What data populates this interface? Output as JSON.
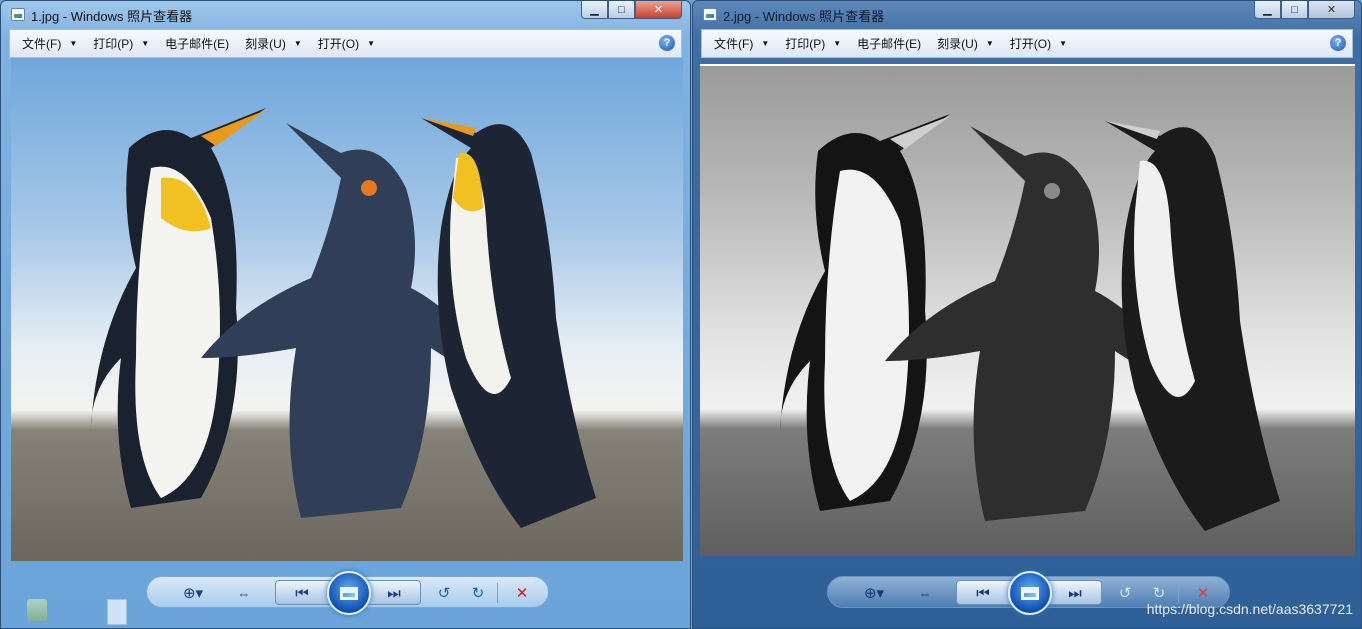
{
  "windows": [
    {
      "title": "1.jpg - Windows 照片查看器",
      "menu": [
        {
          "label": "文件(F)",
          "has_arrow": true
        },
        {
          "label": "打印(P)",
          "has_arrow": true
        },
        {
          "label": "电子邮件(E)",
          "has_arrow": false
        },
        {
          "label": "刻录(U)",
          "has_arrow": true
        },
        {
          "label": "打开(O)",
          "has_arrow": true
        }
      ],
      "image": "color penguins",
      "controls": [
        "zoom-icon",
        "fit-window-icon",
        "previous-icon",
        "slideshow-icon",
        "next-icon",
        "rotate-left-icon",
        "rotate-right-icon",
        "delete-icon"
      ],
      "active": true
    },
    {
      "title": "2.jpg - Windows 照片查看器",
      "menu": [
        {
          "label": "文件(F)",
          "has_arrow": true
        },
        {
          "label": "打印(P)",
          "has_arrow": true
        },
        {
          "label": "电子邮件(E)",
          "has_arrow": false
        },
        {
          "label": "刻录(U)",
          "has_arrow": true
        },
        {
          "label": "打开(O)",
          "has_arrow": true
        }
      ],
      "image": "grayscale penguins",
      "controls": [
        "zoom-icon",
        "fit-window-icon",
        "previous-icon",
        "slideshow-icon",
        "next-icon",
        "rotate-left-icon",
        "rotate-right-icon",
        "delete-icon"
      ],
      "active": false
    }
  ],
  "glyphs": {
    "minimize": "▁",
    "maximize": "□",
    "close": "✕",
    "help": "?",
    "menu_arrow": "▼",
    "zoom": "⊕▾",
    "fit": "⇔",
    "prev": "⏮",
    "next": "⏭",
    "rotate_left": "↺",
    "rotate_right": "↻",
    "delete": "✕"
  },
  "watermark": "https://blog.csdn.net/aas3637721",
  "colors": {
    "win1_frame": "#6aa4d9",
    "win2_frame": "#2f5f97",
    "close_red": "#c7402c",
    "delete_red": "#d41a1a"
  }
}
